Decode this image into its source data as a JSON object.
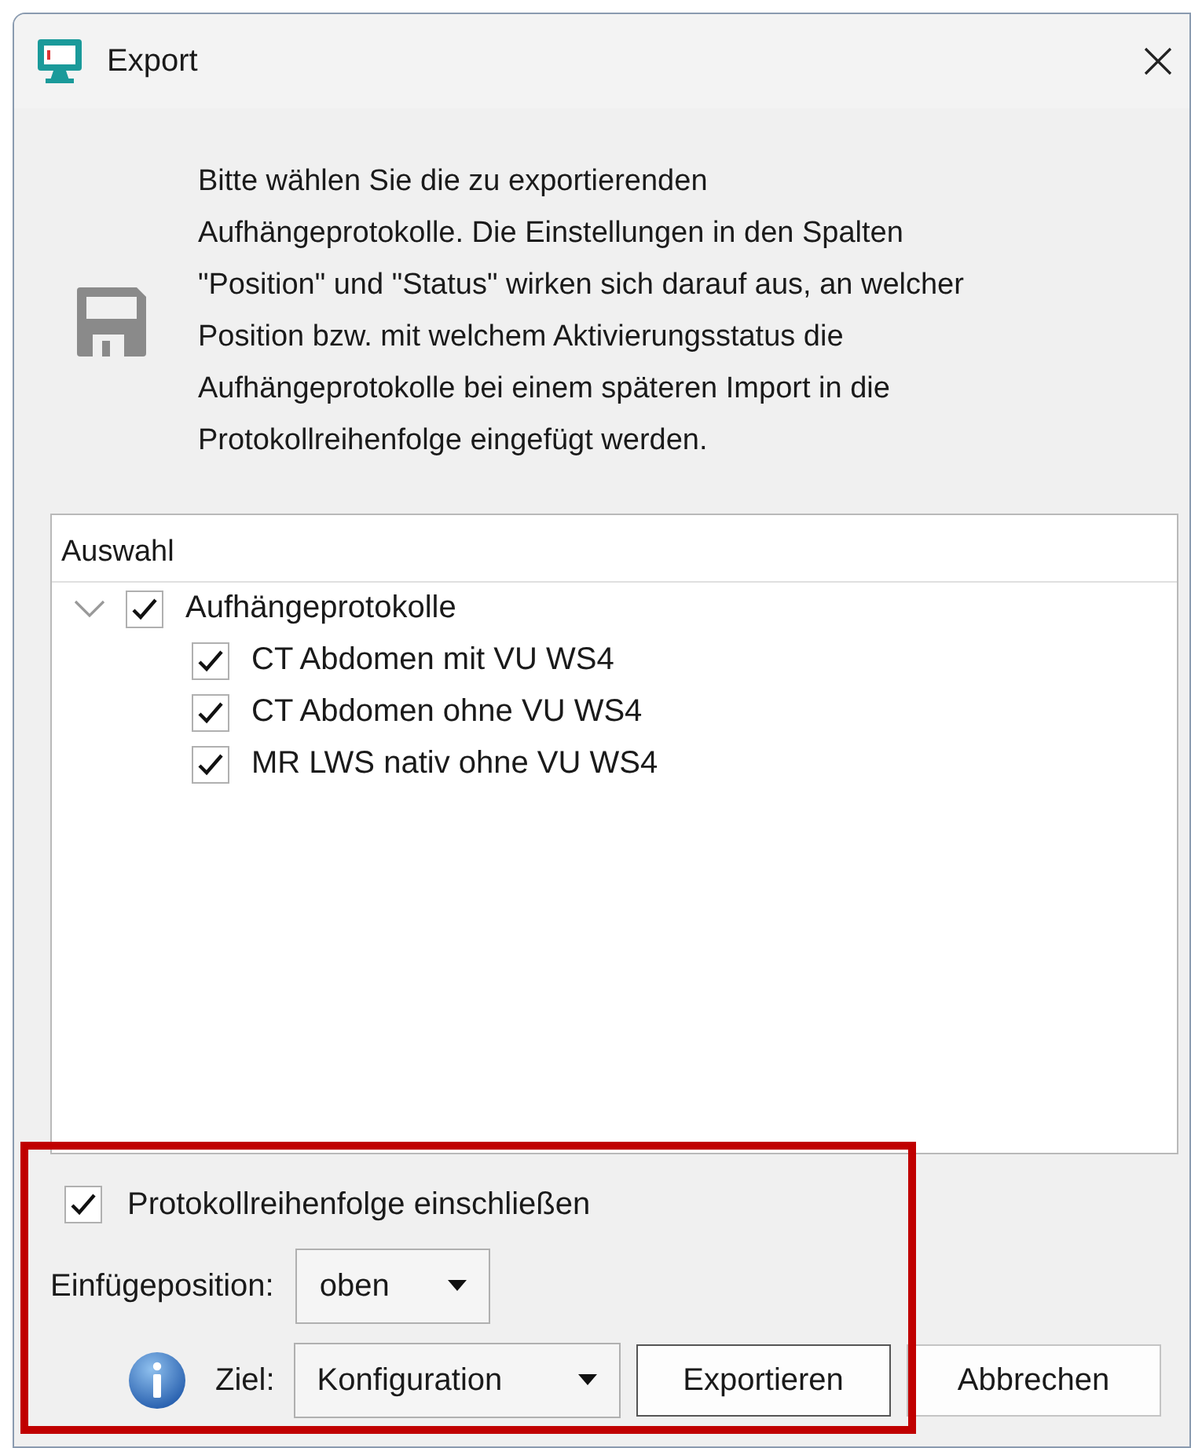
{
  "window": {
    "title": "Export"
  },
  "description": "Bitte wählen Sie die zu exportierenden\nAufhängeprotokolle. Die Einstellungen in den Spalten\n\"Position\" und \"Status\" wirken sich darauf aus, an welcher\nPosition bzw. mit welchem Aktivierungsstatus die\nAufhängeprotokolle bei einem späteren Import in die\nProtokollreihenfolge eingefügt werden.",
  "tree": {
    "column": "Auswahl",
    "items": [
      {
        "label": "Aufhängeprotokolle",
        "checked": true,
        "expanded": true,
        "children": [
          {
            "label": "CT Abdomen mit  VU WS4",
            "checked": true
          },
          {
            "label": "CT Abdomen ohne VU WS4",
            "checked": true
          },
          {
            "label": "MR LWS nativ ohne VU WS4",
            "checked": true
          }
        ]
      }
    ]
  },
  "include_order": {
    "label": "Protokollreihenfolge einschließen",
    "checked": true
  },
  "insert_position": {
    "label": "Einfügeposition:",
    "value": "oben"
  },
  "target": {
    "label": "Ziel:",
    "value": "Konfiguration"
  },
  "buttons": [
    {
      "label": "Exportieren",
      "default": true
    },
    {
      "label": "Abbrechen",
      "default": false
    }
  ],
  "highlight": {
    "color": "#c00000"
  }
}
